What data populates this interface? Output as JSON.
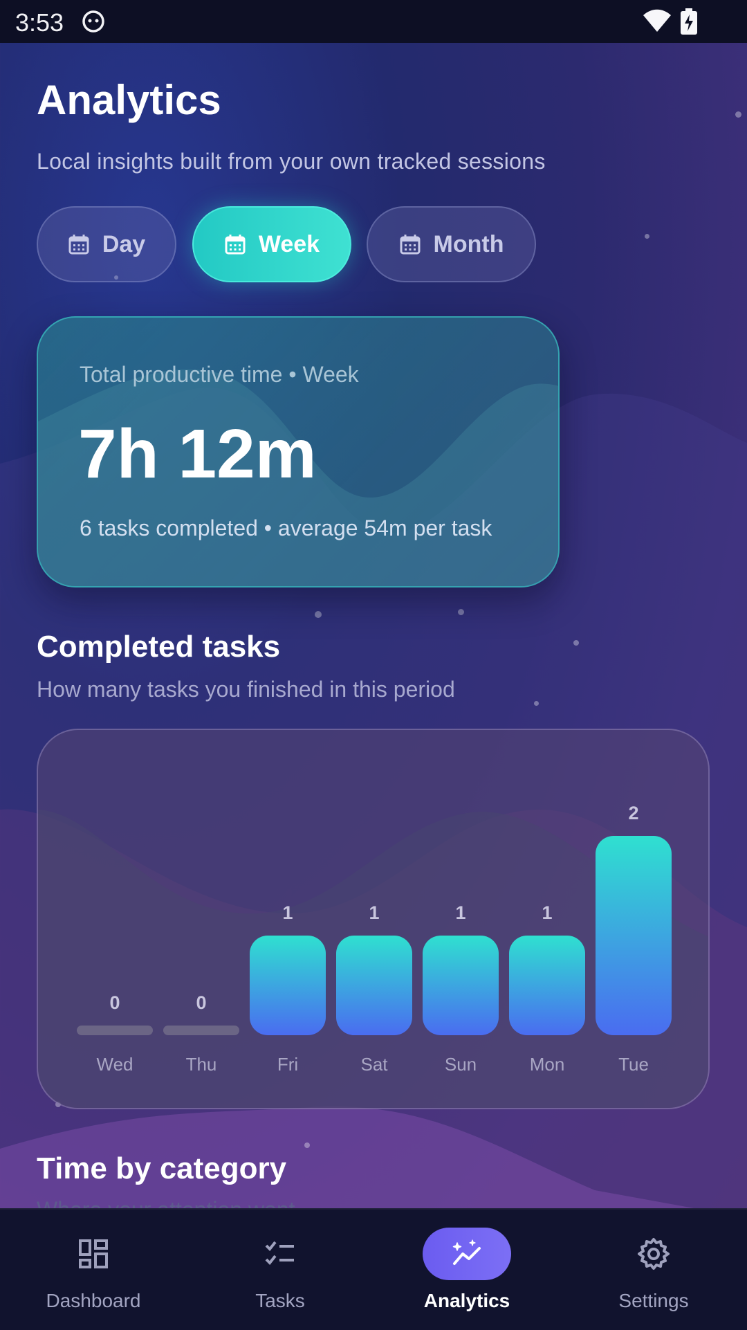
{
  "status_bar": {
    "time": "3:53"
  },
  "header": {
    "title": "Analytics",
    "subtitle": "Local insights built from your own tracked sessions"
  },
  "period_tabs": [
    {
      "label": "Day",
      "selected": false
    },
    {
      "label": "Week",
      "selected": true
    },
    {
      "label": "Month",
      "selected": false
    }
  ],
  "summary": {
    "label": "Total productive time • Week",
    "value": "7h 12m",
    "detail": "6 tasks completed • average 54m per task"
  },
  "completed_section": {
    "title": "Completed tasks",
    "subtitle": "How many tasks you finished in this period"
  },
  "category_section": {
    "title": "Time by category",
    "subtitle": "Where your attention went"
  },
  "chart_data": {
    "type": "bar",
    "categories": [
      "Wed",
      "Thu",
      "Fri",
      "Sat",
      "Sun",
      "Mon",
      "Tue"
    ],
    "values": [
      0,
      0,
      1,
      1,
      1,
      1,
      2
    ],
    "title": "",
    "xlabel": "",
    "ylabel": "",
    "ylim": [
      0,
      2
    ],
    "grid": false,
    "legend": "none",
    "colors": {
      "bar_top": "#2fe0d0",
      "bar_bottom": "#4a6cf0",
      "zero_bar": "#6b6585"
    }
  },
  "bottom_nav": [
    {
      "label": "Dashboard",
      "icon": "dashboard-icon",
      "active": false
    },
    {
      "label": "Tasks",
      "icon": "tasks-icon",
      "active": false
    },
    {
      "label": "Analytics",
      "icon": "analytics-icon",
      "active": true
    },
    {
      "label": "Settings",
      "icon": "settings-icon",
      "active": false
    }
  ],
  "colors": {
    "accent_teal": "#2fd6cc",
    "accent_purple": "#6b5cf0",
    "nav_background": "#11132e"
  }
}
